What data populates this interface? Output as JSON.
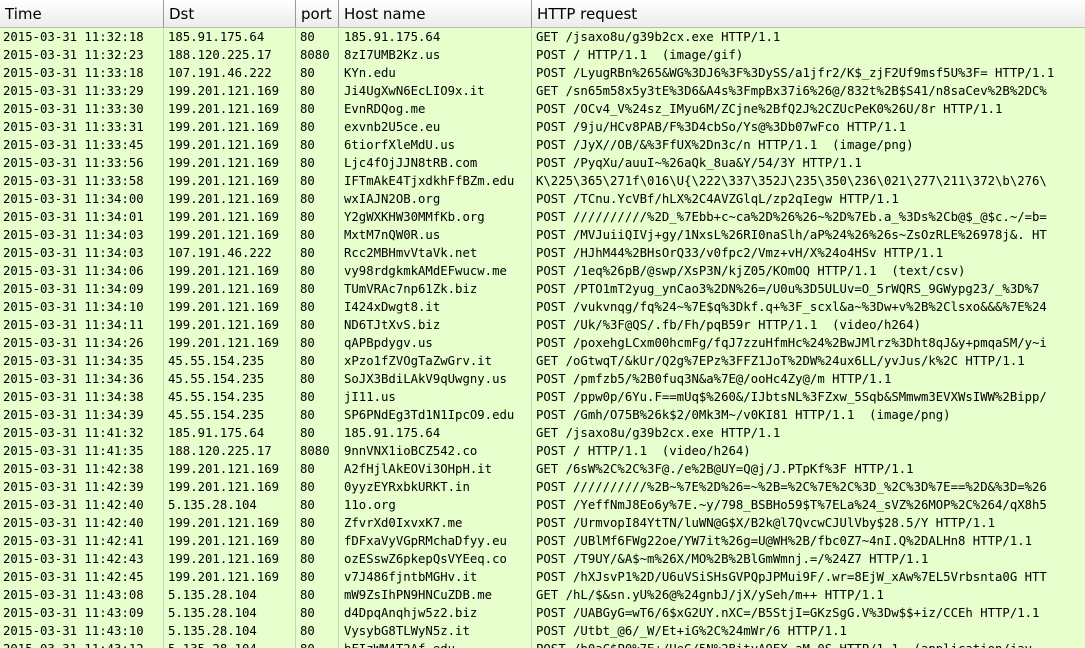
{
  "columns": {
    "time": "Time",
    "dst": "Dst",
    "port": "port",
    "host": "Host name",
    "request": "HTTP request"
  },
  "rows": [
    {
      "time": "2015-03-31 11:32:18",
      "dst": "185.91.175.64",
      "port": "80",
      "host": "185.91.175.64",
      "request": "GET /jsaxo8u/g39b2cx.exe HTTP/1.1"
    },
    {
      "time": "2015-03-31 11:32:23",
      "dst": "188.120.225.17",
      "port": "8080",
      "host": "8zI7UMB2Kz.us",
      "request": "POST / HTTP/1.1  (image/gif)"
    },
    {
      "time": "2015-03-31 11:33:18",
      "dst": "107.191.46.222",
      "port": "80",
      "host": "KYn.edu",
      "request": "POST /LyugRBn%265&WG%3DJ6%3F%3DySS/a1jfr2/K$_zjF2Uf9msf5U%3F= HTTP/1.1"
    },
    {
      "time": "2015-03-31 11:33:29",
      "dst": "199.201.121.169",
      "port": "80",
      "host": "Ji4UgXwN6EcLIO9x.it",
      "request": "GET /sn65m58x5y3tE%3D6&A4s%3FmpBx37i6%26@/832t%2B$S41/n8saCev%2B%2DC%"
    },
    {
      "time": "2015-03-31 11:33:30",
      "dst": "199.201.121.169",
      "port": "80",
      "host": "EvnRDQog.me",
      "request": "POST /OCv4_V%24sz_IMyu6M/ZCjne%2BfQ2J%2CZUcPeK0%26U/8r HTTP/1.1"
    },
    {
      "time": "2015-03-31 11:33:31",
      "dst": "199.201.121.169",
      "port": "80",
      "host": "exvnb2U5ce.eu",
      "request": "POST /9ju/HCv8PAB/F%3D4cbSo/Ys@%3Db07wFco HTTP/1.1"
    },
    {
      "time": "2015-03-31 11:33:45",
      "dst": "199.201.121.169",
      "port": "80",
      "host": "6tiorfXleMdU.us",
      "request": "POST /JyX//OB/&%3FfUX%2Dn3c/n HTTP/1.1  (image/png)"
    },
    {
      "time": "2015-03-31 11:33:56",
      "dst": "199.201.121.169",
      "port": "80",
      "host": "Ljc4fOjJJN8tRB.com",
      "request": "POST /PyqXu/auuI~%26aQk_8ua&Y/54/3Y HTTP/1.1"
    },
    {
      "time": "2015-03-31 11:33:58",
      "dst": "199.201.121.169",
      "port": "80",
      "host": "IFTmAkE4TjxdkhFfBZm.edu",
      "request": "K\\225\\365\\271f\\016\\U{\\222\\337\\352J\\235\\350\\236\\021\\277\\211\\372\\b\\276\\"
    },
    {
      "time": "2015-03-31 11:34:00",
      "dst": "199.201.121.169",
      "port": "80",
      "host": "wxIAJN2OB.org",
      "request": "POST /TCnu.YcVBf/hLX%2C4AVZGlqL/zp2qIegw HTTP/1.1"
    },
    {
      "time": "2015-03-31 11:34:01",
      "dst": "199.201.121.169",
      "port": "80",
      "host": "Y2gWXKHW30MMfKb.org",
      "request": "POST //////////%2D_%7Ebb+c~ca%2D%26%26~%2D%7Eb.a_%3Ds%2Cb@$_@$c.~/=b="
    },
    {
      "time": "2015-03-31 11:34:03",
      "dst": "199.201.121.169",
      "port": "80",
      "host": "MxtM7nQW0R.us",
      "request": "POST /MVJuiiQIVj+gy/1NxsL%26RI0naSlh/aP%24%26%26s~ZsOzRLE%26978j&. HT"
    },
    {
      "time": "2015-03-31 11:34:03",
      "dst": "107.191.46.222",
      "port": "80",
      "host": "Rcc2MBHmvVtaVk.net",
      "request": "POST /HJhM44%2BHsOrQ33/v0fpc2/Vmz+vH/X%24o4HSv HTTP/1.1"
    },
    {
      "time": "2015-03-31 11:34:06",
      "dst": "199.201.121.169",
      "port": "80",
      "host": "vy98rdgkmkAMdEFwucw.me",
      "request": "POST /1eq%26pB/@swp/XsP3N/kjZ05/KOmOQ HTTP/1.1  (text/csv)"
    },
    {
      "time": "2015-03-31 11:34:09",
      "dst": "199.201.121.169",
      "port": "80",
      "host": "TUmVRAc7np61Zk.biz",
      "request": "POST /PTO1mT2yug_ynCao3%2DN%26=/U0u%3D5ULUv=O_5rWQRS_9GWypg23/_%3D%7"
    },
    {
      "time": "2015-03-31 11:34:10",
      "dst": "199.201.121.169",
      "port": "80",
      "host": "I424xDwgt8.it",
      "request": "POST /vukvnqg/fq%24~%7E$q%3Dkf.q+%3F_scxl&a~%3Dw+v%2B%2Clsxo&&&%7E%24"
    },
    {
      "time": "2015-03-31 11:34:11",
      "dst": "199.201.121.169",
      "port": "80",
      "host": "ND6TJtXvS.biz",
      "request": "POST /Uk/%3F@QS/.fb/Fh/pqB59r HTTP/1.1  (video/h264)"
    },
    {
      "time": "2015-03-31 11:34:26",
      "dst": "199.201.121.169",
      "port": "80",
      "host": "qAPBpdygv.us",
      "request": "POST /poxehgLCxm00hcmFg/fqJ7zzuHfmHc%24%2BwJMlrz%3Dht8qJ&y+pmqaSM/y~i"
    },
    {
      "time": "2015-03-31 11:34:35",
      "dst": "45.55.154.235",
      "port": "80",
      "host": "xPzo1fZVOgTaZwGrv.it",
      "request": "GET /oGtwqT/&kUr/Q2g%7EPz%3FFZ1JoT%2DW%24ux6LL/yvJus/k%2C HTTP/1.1"
    },
    {
      "time": "2015-03-31 11:34:36",
      "dst": "45.55.154.235",
      "port": "80",
      "host": "SoJX3BdiLAkV9qUwgny.us",
      "request": "POST /pmfzb5/%2B0fuq3N&a%7E@/ooHc4Zy@/m HTTP/1.1"
    },
    {
      "time": "2015-03-31 11:34:38",
      "dst": "45.55.154.235",
      "port": "80",
      "host": "jI11.us",
      "request": "POST /ppw0p/6Yu.F==mUq$%260&/IJbtsNL%3FZxw_5Sqb&SMmwm3EVXWsIWW%2Bipp/"
    },
    {
      "time": "2015-03-31 11:34:39",
      "dst": "45.55.154.235",
      "port": "80",
      "host": "SP6PNdEg3Td1N1IpcO9.edu",
      "request": "POST /Gmh/O75B%26k$2/0Mk3M~/v0KI81 HTTP/1.1  (image/png)"
    },
    {
      "time": "2015-03-31 11:41:32",
      "dst": "185.91.175.64",
      "port": "80",
      "host": "185.91.175.64",
      "request": "GET /jsaxo8u/g39b2cx.exe HTTP/1.1"
    },
    {
      "time": "2015-03-31 11:41:35",
      "dst": "188.120.225.17",
      "port": "8080",
      "host": "9nnVNX1ioBCZ542.co",
      "request": "POST / HTTP/1.1  (video/h264)"
    },
    {
      "time": "2015-03-31 11:42:38",
      "dst": "199.201.121.169",
      "port": "80",
      "host": "A2fHjlAkEOVi3OHpH.it",
      "request": "GET /6sW%2C%2C%3F@./e%2B@UY=Q@j/J.PTpKf%3F HTTP/1.1"
    },
    {
      "time": "2015-03-31 11:42:39",
      "dst": "199.201.121.169",
      "port": "80",
      "host": "0yyzEYRxbkURKT.in",
      "request": "POST //////////%2B~%7E%2D%26=~%2B=%2C%7E%2C%3D_%2C%3D%7E==%2D&%3D=%26"
    },
    {
      "time": "2015-03-31 11:42:40",
      "dst": "5.135.28.104",
      "port": "80",
      "host": "11o.org",
      "request": "POST /YeffNmJ8Eo6y%7E.~y/798_BSBHo59$T%7ELa%24_sVZ%26MOP%2C%264/qX8h5"
    },
    {
      "time": "2015-03-31 11:42:40",
      "dst": "199.201.121.169",
      "port": "80",
      "host": "ZfvrXd0IxvxK7.me",
      "request": "POST /UrmvopI84YtTN/luWN@G$X/B2k@l7QvcwCJUlVby$28.5/Y HTTP/1.1"
    },
    {
      "time": "2015-03-31 11:42:41",
      "dst": "199.201.121.169",
      "port": "80",
      "host": "fDFxaVyVGpRMchaDfyy.eu",
      "request": "POST /UBlMf6FWg22oe/YW7it%26g=U@WH%2B/fbc0Z7~4nI.Q%2DALHn8 HTTP/1.1"
    },
    {
      "time": "2015-03-31 11:42:43",
      "dst": "199.201.121.169",
      "port": "80",
      "host": "ozESswZ6pkepQsVYEeq.co",
      "request": "POST /T9UY/&A$~m%26X/MO%2B%2BlGmWmnj.=/%24Z7 HTTP/1.1"
    },
    {
      "time": "2015-03-31 11:42:45",
      "dst": "199.201.121.169",
      "port": "80",
      "host": "v7J486fjntbMGHv.it",
      "request": "POST /hXJsvP1%2D/U6uVSiSHsGVPQpJPMui9F/.wr=8EjW_xAw%7EL5Vrbsnta0G HTT"
    },
    {
      "time": "2015-03-31 11:43:08",
      "dst": "5.135.28.104",
      "port": "80",
      "host": "mW9ZsIhPN9HNCuZDB.me",
      "request": "GET /hL/$&sn.yU%26@%24gnbJ/jX/ySeh/m++ HTTP/1.1"
    },
    {
      "time": "2015-03-31 11:43:09",
      "dst": "5.135.28.104",
      "port": "80",
      "host": "d4DpqAnqhjw5z2.biz",
      "request": "POST /UABGyG=wT6/6$xG2UY.nXC=/B5StjI=GKzSgG.V%3Dw$$+iz/CCEh HTTP/1.1"
    },
    {
      "time": "2015-03-31 11:43:10",
      "dst": "5.135.28.104",
      "port": "80",
      "host": "VysybG8TLWyN5z.it",
      "request": "POST /Utbt_@6/_W/Et+iG%2C%24mWr/6 HTTP/1.1"
    },
    {
      "time": "2015-03-31 11:43:12",
      "dst": "5.135.28.104",
      "port": "80",
      "host": "bFIzWM4T2Af.edu",
      "request": "POST /b0aC$P0%7E+/UeG/5N%2BityA9EX_aM.0S HTTP/1.1  (application/jav"
    }
  ]
}
